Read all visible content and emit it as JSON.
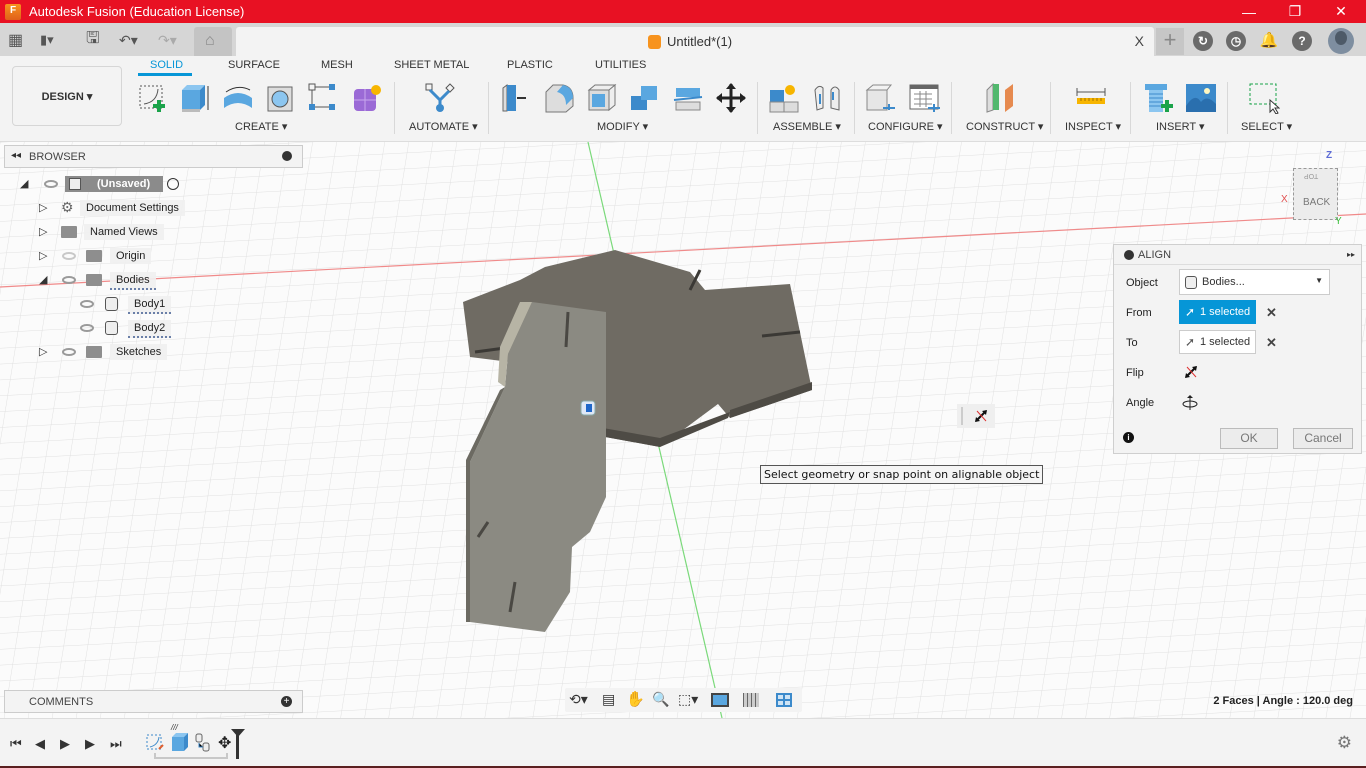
{
  "window": {
    "title": "Autodesk Fusion (Education License)",
    "app_logo_letter": "F",
    "controls": {
      "minimize": "—",
      "restore": "❐",
      "close": "✕"
    }
  },
  "quick_access": {
    "icons": [
      "apps-grid-icon",
      "file-icon",
      "save-icon",
      "undo-icon",
      "redo-icon",
      "home-icon"
    ],
    "grid_glyph": "▦",
    "file_glyph": "▮▾",
    "save_glyph": "🖫",
    "undo_glyph": "↶▾",
    "redo_glyph": "↷▾",
    "home_glyph": "⌂"
  },
  "document_tab": {
    "title": "Untitled*(1)",
    "close": "X"
  },
  "right_icons": {
    "new_tab": "+",
    "extensions": "↻",
    "job_status": "◷",
    "notifications": "🔔",
    "help": "?"
  },
  "toolbar": {
    "workspace": "DESIGN ▾",
    "tabs": [
      {
        "label": "SOLID",
        "active": true
      },
      {
        "label": "SURFACE",
        "active": false
      },
      {
        "label": "MESH",
        "active": false
      },
      {
        "label": "SHEET METAL",
        "active": false
      },
      {
        "label": "PLASTIC",
        "active": false
      },
      {
        "label": "UTILITIES",
        "active": false
      }
    ],
    "groups": [
      {
        "label": "CREATE ▾",
        "tools": [
          "create-sketch",
          "extrude",
          "revolve",
          "hole",
          "pattern",
          "create-form"
        ]
      },
      {
        "label": "AUTOMATE ▾",
        "tools": [
          "automate"
        ]
      },
      {
        "label": "MODIFY ▾",
        "tools": [
          "press-pull",
          "fillet",
          "shell",
          "combine",
          "split-body",
          "move-copy"
        ]
      },
      {
        "label": "ASSEMBLE ▾",
        "tools": [
          "new-component",
          "joint"
        ]
      },
      {
        "label": "CONFIGURE ▾",
        "tools": [
          "configure",
          "configuration-table"
        ]
      },
      {
        "label": "CONSTRUCT ▾",
        "tools": [
          "offset-plane"
        ]
      },
      {
        "label": "INSPECT ▾",
        "tools": [
          "measure"
        ]
      },
      {
        "label": "INSERT ▾",
        "tools": [
          "insert-mcmaster",
          "insert-canvas"
        ]
      },
      {
        "label": "SELECT ▾",
        "tools": [
          "window-select"
        ]
      }
    ]
  },
  "browser": {
    "title": "BROWSER",
    "items": [
      {
        "label": "(Unsaved)",
        "type": "root",
        "expanded": true
      },
      {
        "label": "Document Settings",
        "type": "settings",
        "expanded": false
      },
      {
        "label": "Named Views",
        "type": "folder",
        "expanded": false
      },
      {
        "label": "Origin",
        "type": "folder",
        "visible": false,
        "expanded": false
      },
      {
        "label": "Bodies",
        "type": "folder",
        "expanded": true
      },
      {
        "label": "Body1",
        "type": "body"
      },
      {
        "label": "Body2",
        "type": "body"
      },
      {
        "label": "Sketches",
        "type": "folder",
        "expanded": false
      }
    ]
  },
  "align_dialog": {
    "title": "ALIGN",
    "object_label": "Object",
    "object_value": "Bodies...",
    "from_label": "From",
    "from_value": "1 selected",
    "to_label": "To",
    "to_value": "1 selected",
    "flip_label": "Flip",
    "angle_label": "Angle",
    "ok": "OK",
    "cancel": "Cancel",
    "clear": "✕",
    "info": "i",
    "expand": "▸▸"
  },
  "viewcube": {
    "face": "BACK",
    "top": "TOP",
    "axis_x": "X",
    "axis_y": "Y",
    "axis_z": "Z"
  },
  "tooltip": "Select geometry or snap point on alignable object",
  "status": "2 Faces | Angle : 120.0 deg",
  "comments": {
    "title": "COMMENTS"
  },
  "nav_bar": {
    "tools": [
      "orbit",
      "look-at",
      "pan",
      "zoom",
      "fit",
      "display-settings",
      "grid-snaps",
      "viewports"
    ]
  },
  "timeline": {
    "controls": [
      "⏮",
      "◀",
      "▶",
      "▶",
      "⏭"
    ],
    "features": [
      "sketch",
      "extrude",
      "align",
      "move"
    ]
  }
}
